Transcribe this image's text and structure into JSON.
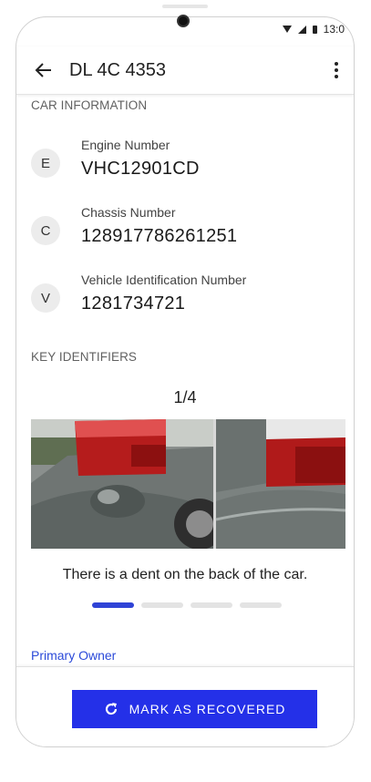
{
  "status_bar": {
    "time": "13:0"
  },
  "app_bar": {
    "title": "DL 4C 4353",
    "back_icon": "arrow-left-icon",
    "menu_icon": "more-vertical-icon"
  },
  "car_information": {
    "heading": "CAR INFORMATION",
    "items": [
      {
        "initial": "E",
        "label": "Engine Number",
        "value": "VHC12901CD"
      },
      {
        "initial": "C",
        "label": "Chassis Number",
        "value": "128917786261251"
      },
      {
        "initial": "V",
        "label": "Vehicle Identification Number",
        "value": "1281734721"
      }
    ]
  },
  "key_identifiers": {
    "heading": "KEY IDENTIFIERS",
    "counter": "1/4",
    "caption": "There is a dent on the back of the car.",
    "pager": {
      "total": 4,
      "active_index": 0
    }
  },
  "primary_owner": {
    "label": "Primary Owner"
  },
  "recover_button": {
    "label": "MARK AS RECOVERED",
    "icon": "refresh-icon"
  },
  "colors": {
    "accent": "#2430e8",
    "link": "#2b4ad9",
    "pager_active": "#2f43d6"
  }
}
